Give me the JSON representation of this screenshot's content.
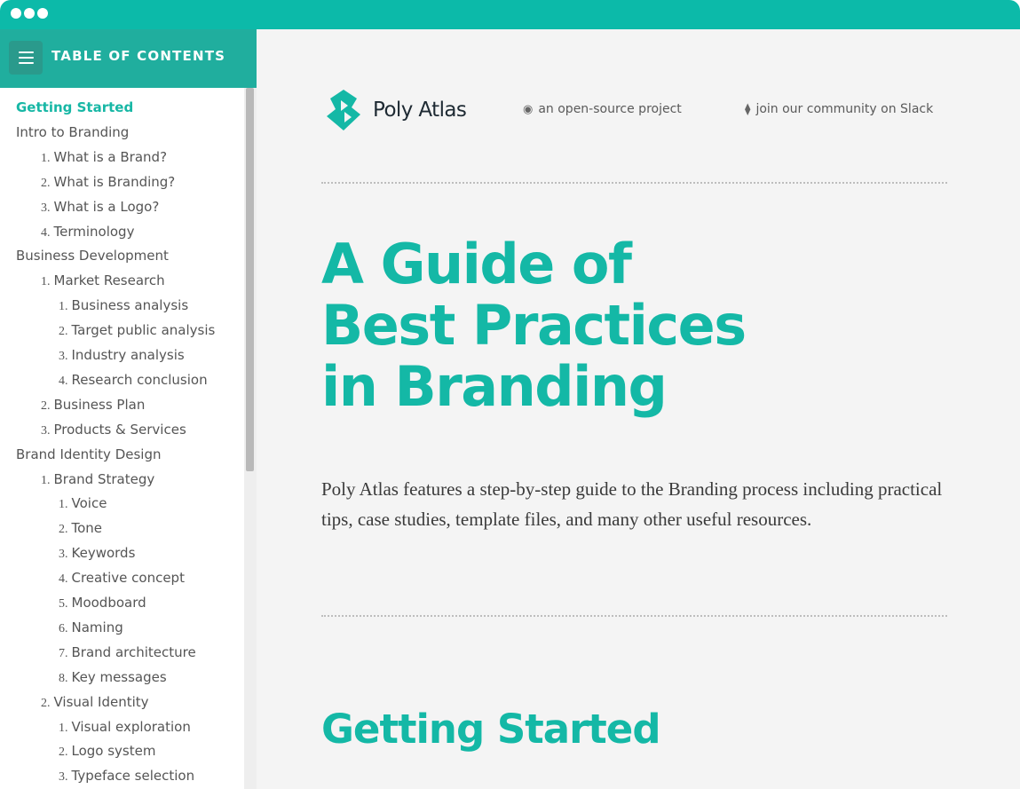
{
  "colors": {
    "accent": "#14b8a6",
    "titlebar": "#0cbaa9",
    "toc_header": "#20ae9e"
  },
  "sidebar": {
    "title": "TABLE OF CONTENTS",
    "menu_icon": "hamburger-menu-icon",
    "items": [
      {
        "num": "",
        "label": "Getting Started",
        "level": 0,
        "active": true
      },
      {
        "num": "",
        "label": "Intro to Branding",
        "level": 0
      },
      {
        "num": "1.",
        "label": "What is a Brand?",
        "level": 1
      },
      {
        "num": "2.",
        "label": "What is Branding?",
        "level": 1
      },
      {
        "num": "3.",
        "label": "What is a Logo?",
        "level": 1
      },
      {
        "num": "4.",
        "label": "Terminology",
        "level": 1
      },
      {
        "num": "",
        "label": "Business Development",
        "level": 0
      },
      {
        "num": "1.",
        "label": "Market Research",
        "level": 1
      },
      {
        "num": "1.",
        "label": "Business analysis",
        "level": 2
      },
      {
        "num": "2.",
        "label": "Target public analysis",
        "level": 2
      },
      {
        "num": "3.",
        "label": "Industry analysis",
        "level": 2
      },
      {
        "num": "4.",
        "label": "Research conclusion",
        "level": 2
      },
      {
        "num": "2.",
        "label": "Business Plan",
        "level": 1
      },
      {
        "num": "3.",
        "label": "Products & Services",
        "level": 1
      },
      {
        "num": "",
        "label": "Brand Identity Design",
        "level": 0
      },
      {
        "num": "1.",
        "label": "Brand Strategy",
        "level": 1
      },
      {
        "num": "1.",
        "label": "Voice",
        "level": 2
      },
      {
        "num": "2.",
        "label": "Tone",
        "level": 2
      },
      {
        "num": "3.",
        "label": "Keywords",
        "level": 2
      },
      {
        "num": "4.",
        "label": "Creative concept",
        "level": 2
      },
      {
        "num": "5.",
        "label": "Moodboard",
        "level": 2
      },
      {
        "num": "6.",
        "label": "Naming",
        "level": 2
      },
      {
        "num": "7.",
        "label": "Brand architecture",
        "level": 2
      },
      {
        "num": "8.",
        "label": "Key messages",
        "level": 2
      },
      {
        "num": "2.",
        "label": "Visual Identity",
        "level": 1
      },
      {
        "num": "1.",
        "label": "Visual exploration",
        "level": 2
      },
      {
        "num": "2.",
        "label": "Logo system",
        "level": 2
      },
      {
        "num": "3.",
        "label": "Typeface selection",
        "level": 2
      }
    ]
  },
  "header": {
    "brand": "Poly Atlas",
    "links": [
      {
        "icon": "github-icon",
        "label": "an open-source project"
      },
      {
        "icon": "slack-icon",
        "label": "join our community on Slack"
      }
    ]
  },
  "main": {
    "hero_lines": [
      "A Guide of",
      "Best Practices",
      "in Branding"
    ],
    "intro": "Poly Atlas features a step-by-step guide to the Branding process including practical tips, case studies, template files, and many other useful resources.",
    "section_title": "Getting Started"
  }
}
